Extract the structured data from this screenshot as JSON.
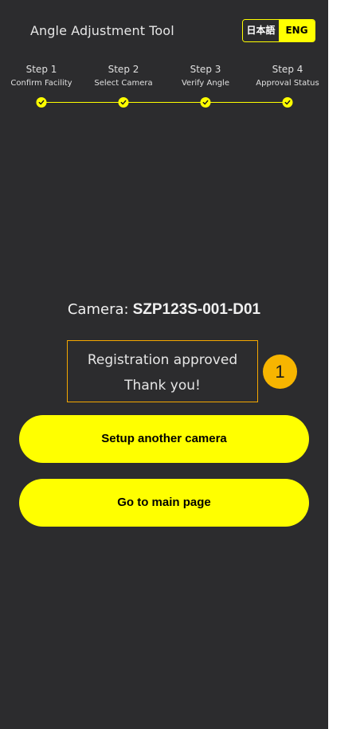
{
  "header": {
    "title": "Angle Adjustment Tool",
    "languages": [
      {
        "label": "日本語",
        "active": false
      },
      {
        "label": "ENG",
        "active": true
      }
    ]
  },
  "steps": [
    {
      "number": "Step 1",
      "label": "Confirm Facility",
      "completed": true
    },
    {
      "number": "Step 2",
      "label": "Select Camera",
      "completed": true
    },
    {
      "number": "Step 3",
      "label": "Verify Angle",
      "completed": true
    },
    {
      "number": "Step 4",
      "label": "Approval Status",
      "completed": true
    }
  ],
  "camera": {
    "label": "Camera:",
    "id": "SZP123S-001-D01"
  },
  "status": {
    "line1": "Registration approved",
    "line2": "Thank you!"
  },
  "annotation": {
    "badge": "1"
  },
  "actions": {
    "setup_another": "Setup another camera",
    "go_main": "Go to main page"
  },
  "colors": {
    "background": "#2c2c2e",
    "accent": "#ffff00",
    "status_border": "#f5a800",
    "badge": "#f7b500"
  }
}
